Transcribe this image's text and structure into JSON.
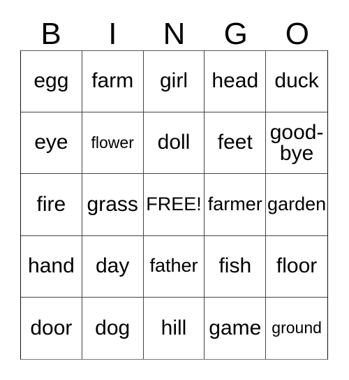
{
  "card": {
    "title": "BINGO",
    "background_color": "#ffffff",
    "text_color": "#000000",
    "border_color": "#444444"
  },
  "header": {
    "letters": [
      "B",
      "I",
      "N",
      "G",
      "O"
    ]
  },
  "grid": {
    "columns": 5,
    "rows": 5,
    "free_space": "FREE!",
    "cells": [
      [
        {
          "text": "egg",
          "size": "lg"
        },
        {
          "text": "farm",
          "size": "lg"
        },
        {
          "text": "girl",
          "size": "lg"
        },
        {
          "text": "head",
          "size": "lg"
        },
        {
          "text": "duck",
          "size": "lg"
        }
      ],
      [
        {
          "text": "eye",
          "size": "lg"
        },
        {
          "text": "flower",
          "size": "sm"
        },
        {
          "text": "doll",
          "size": "lg"
        },
        {
          "text": "feet",
          "size": "lg"
        },
        {
          "text": "good-bye",
          "size": "lg",
          "wrap": true
        }
      ],
      [
        {
          "text": "fire",
          "size": "lg"
        },
        {
          "text": "grass",
          "size": "lg"
        },
        {
          "text": "FREE!",
          "size": "md"
        },
        {
          "text": "farmer",
          "size": "md"
        },
        {
          "text": "garden",
          "size": "md"
        }
      ],
      [
        {
          "text": "hand",
          "size": "lg"
        },
        {
          "text": "day",
          "size": "lg"
        },
        {
          "text": "father",
          "size": "md"
        },
        {
          "text": "fish",
          "size": "lg"
        },
        {
          "text": "floor",
          "size": "lg"
        }
      ],
      [
        {
          "text": "door",
          "size": "lg"
        },
        {
          "text": "dog",
          "size": "lg"
        },
        {
          "text": "hill",
          "size": "lg"
        },
        {
          "text": "game",
          "size": "lg"
        },
        {
          "text": "ground",
          "size": "sm"
        }
      ]
    ]
  }
}
